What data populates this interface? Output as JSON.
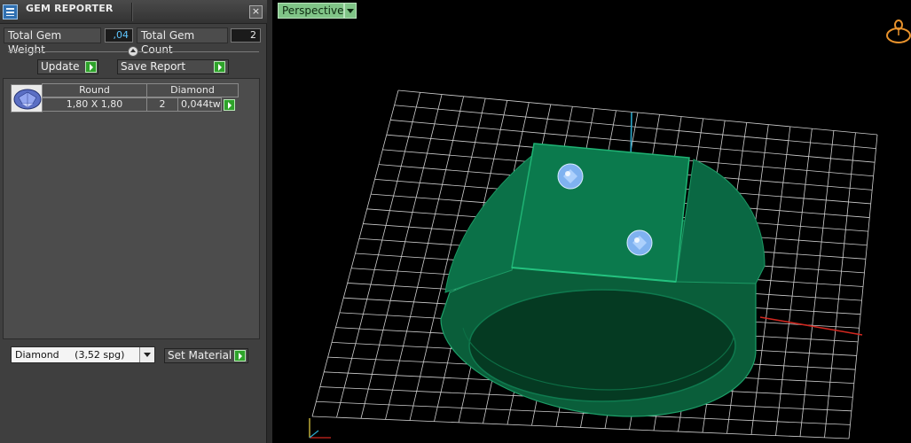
{
  "panel": {
    "title": "GEM REPORTER",
    "close_glyph": "×",
    "total_weight_label": "Total Gem Weight",
    "total_weight_value": ",04",
    "total_count_label": "Total Gem Count",
    "total_count_value": "2",
    "update_label": "Update",
    "save_report_label": "Save Report",
    "set_material_label": "Set Material",
    "material_selected": "Diamond     (3,52 spg)"
  },
  "gem_table": {
    "headers": [
      "Round",
      "Diamond"
    ],
    "rows": [
      {
        "size": "1,80 X 1,80",
        "count": "2",
        "weight": "0,044tw"
      }
    ]
  },
  "viewport": {
    "view_name": "Perspective"
  },
  "icons": [
    "table-icon",
    "close-icon",
    "slider-knob-icon",
    "play-arrow-icon",
    "gem-thumbnail-icon",
    "dropdown-arrow-icon",
    "ring-orientation-icon",
    "axis-indicator-icon"
  ],
  "colors": {
    "ring": "#0b7a4d",
    "gem": "#7fb2f0",
    "grid": "#d8d8d8",
    "x_axis": "#d0271f",
    "y_axis": "#2aa6c8",
    "tab": "#80c487",
    "button_arrow": "#2ea32a"
  }
}
